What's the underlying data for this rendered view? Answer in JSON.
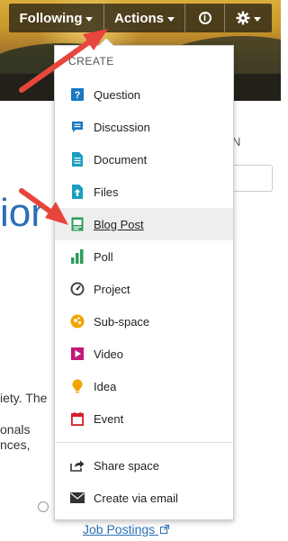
{
  "toolbar": {
    "following_label": "Following",
    "actions_label": "Actions",
    "info_icon": "info-icon",
    "settings_icon": "gear-icon"
  },
  "background": {
    "heading_fragment": "ior",
    "side_label_fragment": "N",
    "text_line_1": "iety. The",
    "text_line_2": "onals",
    "text_line_3": "nces,",
    "link_label": "Job Postings"
  },
  "dropdown": {
    "section_title": "CREATE",
    "create_items": [
      {
        "label": "Question",
        "icon": "question-icon",
        "color": "#1a78c2"
      },
      {
        "label": "Discussion",
        "icon": "discussion-icon",
        "color": "#1a78c2"
      },
      {
        "label": "Document",
        "icon": "document-icon",
        "color": "#1a9fc2"
      },
      {
        "label": "Files",
        "icon": "files-icon",
        "color": "#1a9fc2"
      },
      {
        "label": "Blog Post",
        "icon": "blog-post-icon",
        "color": "#2e9c5a"
      },
      {
        "label": "Poll",
        "icon": "poll-icon",
        "color": "#2e9c5a"
      },
      {
        "label": "Project",
        "icon": "project-icon",
        "color": "#444444"
      },
      {
        "label": "Sub-space",
        "icon": "subspace-icon",
        "color": "#f0a500"
      },
      {
        "label": "Video",
        "icon": "video-icon",
        "color": "#c2187a"
      },
      {
        "label": "Idea",
        "icon": "idea-icon",
        "color": "#f0a500"
      },
      {
        "label": "Event",
        "icon": "event-icon",
        "color": "#d0202a"
      }
    ],
    "other_items": [
      {
        "label": "Share space",
        "icon": "share-icon"
      },
      {
        "label": "Create via email",
        "icon": "email-icon"
      }
    ],
    "highlighted_item": "Blog Post"
  },
  "colors": {
    "arrow": "#e8453c",
    "link": "#2a6fb7"
  }
}
